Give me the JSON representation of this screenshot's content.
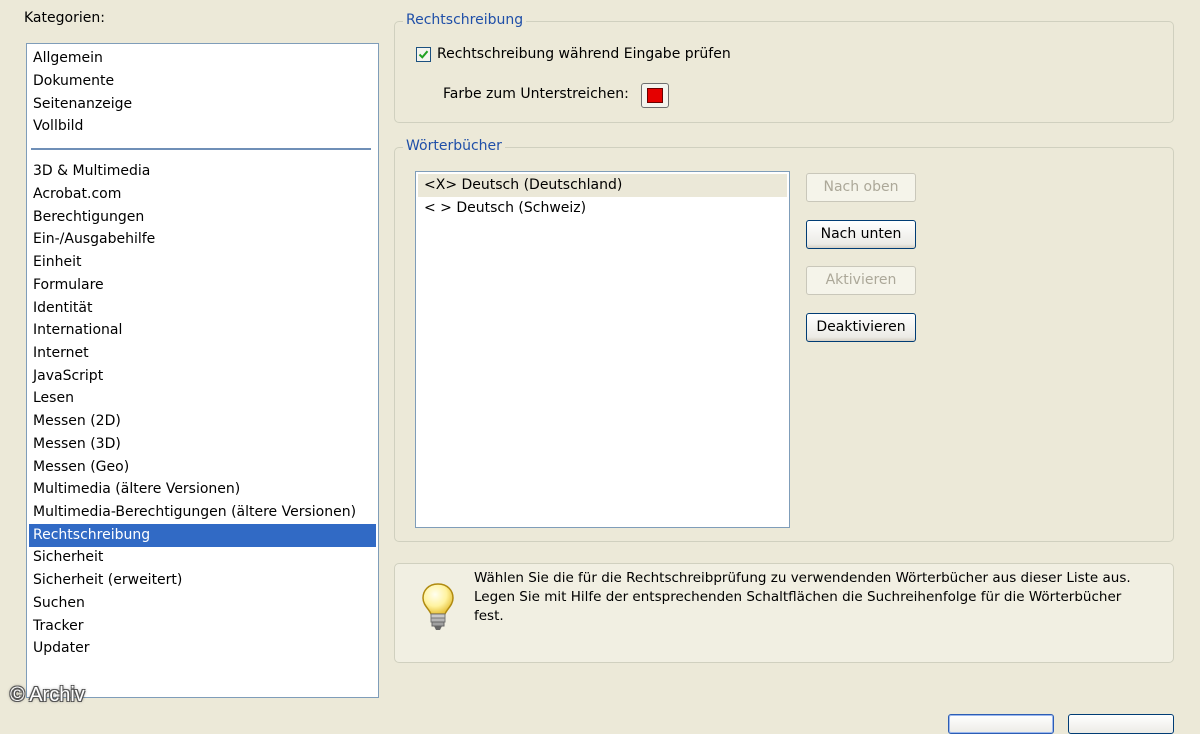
{
  "categories": {
    "label": "Kategorien:",
    "group_top": [
      "Allgemein",
      "Dokumente",
      "Seitenanzeige",
      "Vollbild"
    ],
    "group_bottom": [
      "3D & Multimedia",
      "Acrobat.com",
      "Berechtigungen",
      "Ein-/Ausgabehilfe",
      "Einheit",
      "Formulare",
      "Identität",
      "International",
      "Internet",
      "JavaScript",
      "Lesen",
      "Messen (2D)",
      "Messen (3D)",
      "Messen (Geo)",
      "Multimedia (ältere Versionen)",
      "Multimedia-Berechtigungen (ältere Versionen)",
      "Rechtschreibung",
      "Sicherheit",
      "Sicherheit (erweitert)",
      "Suchen",
      "Tracker",
      "Updater"
    ],
    "selected": "Rechtschreibung"
  },
  "spelling": {
    "legend": "Rechtschreibung",
    "check_label": "Rechtschreibung während Eingabe prüfen",
    "checked": true,
    "color_label": "Farbe zum Unterstreichen:",
    "underline_color": "#e50000"
  },
  "dictionaries": {
    "legend": "Wörterbücher",
    "items": [
      "<X> Deutsch (Deutschland)",
      "< > Deutsch (Schweiz)"
    ],
    "selected_index": 0,
    "buttons": {
      "up": "Nach oben",
      "down": "Nach unten",
      "activate": "Aktivieren",
      "deactivate": "Deaktivieren"
    }
  },
  "hint": {
    "icon": "lightbulb-icon",
    "text": "Wählen Sie die für die Rechtschreibprüfung zu verwendenden Wörterbücher aus dieser Liste aus. Legen Sie mit Hilfe der entsprechenden Schaltflächen die Suchreihenfolge für die Wörterbücher fest."
  },
  "watermark": "© Archiv",
  "colors": {
    "selection": "#316ac5",
    "legend_text": "#1f4fa8",
    "dialog_bg": "#ece9d8"
  }
}
